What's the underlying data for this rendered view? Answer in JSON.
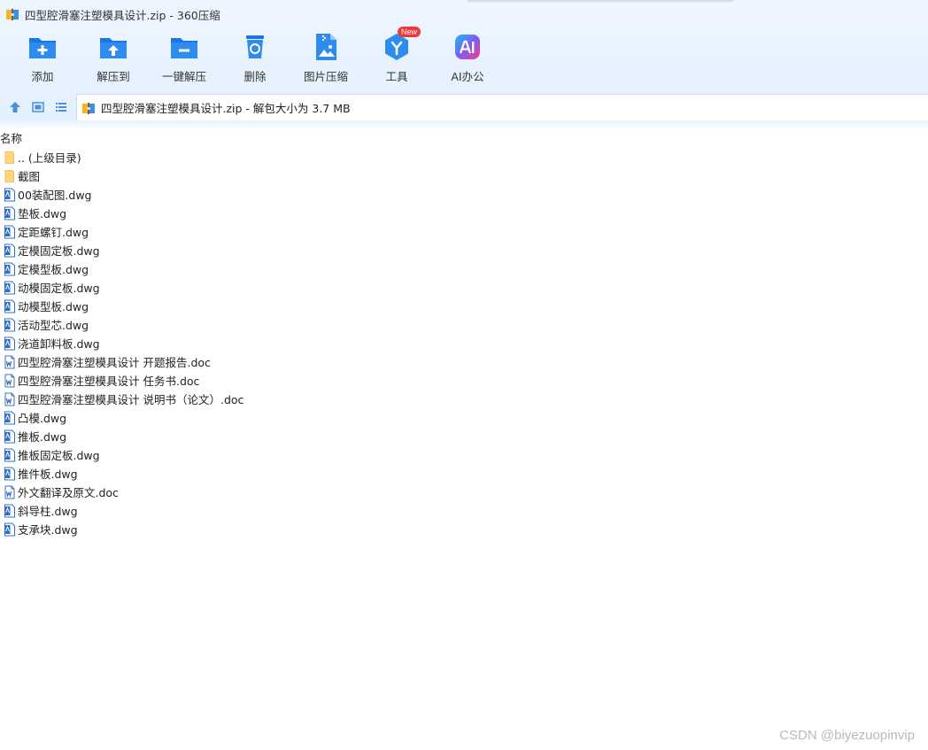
{
  "window": {
    "title": "四型腔滑塞注塑模具设计.zip - 360压缩"
  },
  "toolbar": {
    "items": [
      {
        "label": "添加",
        "icon": "add-folder-icon"
      },
      {
        "label": "解压到",
        "icon": "extract-to-icon"
      },
      {
        "label": "一键解压",
        "icon": "one-click-extract-icon"
      },
      {
        "label": "删除",
        "icon": "delete-icon"
      },
      {
        "label": "图片压缩",
        "icon": "image-compress-icon"
      },
      {
        "label": "工具",
        "icon": "tools-icon",
        "badge": "New"
      },
      {
        "label": "AI办公",
        "icon": "ai-office-icon"
      }
    ]
  },
  "address": {
    "path": "四型腔滑塞注塑模具设计.zip - 解包大小为 3.7 MB"
  },
  "list": {
    "column_name": "名称",
    "files": [
      {
        "name": ".. (上级目录)",
        "type": "folder"
      },
      {
        "name": "截图",
        "type": "folder"
      },
      {
        "name": "00装配图.dwg",
        "type": "dwg"
      },
      {
        "name": "垫板.dwg",
        "type": "dwg"
      },
      {
        "name": "定距螺钉.dwg",
        "type": "dwg"
      },
      {
        "name": "定模固定板.dwg",
        "type": "dwg"
      },
      {
        "name": "定模型板.dwg",
        "type": "dwg"
      },
      {
        "name": "动模固定板.dwg",
        "type": "dwg"
      },
      {
        "name": "动模型板.dwg",
        "type": "dwg"
      },
      {
        "name": "活动型芯.dwg",
        "type": "dwg"
      },
      {
        "name": "浇道卸料板.dwg",
        "type": "dwg"
      },
      {
        "name": "四型腔滑塞注塑模具设计 开题报告.doc",
        "type": "doc"
      },
      {
        "name": "四型腔滑塞注塑模具设计 任务书.doc",
        "type": "doc"
      },
      {
        "name": "四型腔滑塞注塑模具设计 说明书（论文）.doc",
        "type": "doc"
      },
      {
        "name": "凸模.dwg",
        "type": "dwg"
      },
      {
        "name": "推板.dwg",
        "type": "dwg"
      },
      {
        "name": "推板固定板.dwg",
        "type": "dwg"
      },
      {
        "name": "推件板.dwg",
        "type": "dwg"
      },
      {
        "name": "外文翻译及原文.doc",
        "type": "doc"
      },
      {
        "name": "斜导柱.dwg",
        "type": "dwg"
      },
      {
        "name": "支承块.dwg",
        "type": "dwg"
      }
    ]
  },
  "watermark": "CSDN @biyezuopinvip",
  "colors": {
    "accent": "#1e88e5",
    "toolbar_bg": "#e7f2ff",
    "folder": "#ffd77a"
  }
}
